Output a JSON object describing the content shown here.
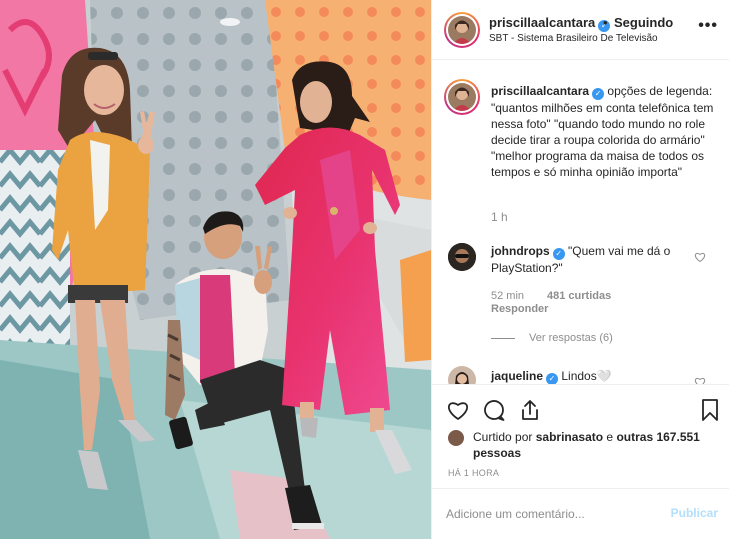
{
  "post": {
    "username": "priscillaalcantara",
    "separator": "•",
    "follow_status": "Seguindo",
    "location": "SBT - Sistema Brasileiro De Televisão",
    "more_label": "•••"
  },
  "caption": {
    "username": "priscillaalcantara",
    "text": "opções de legenda: \"quantos milhões em conta telefônica tem nessa foto\" \"quando todo mundo no role decide tirar a roupa colorida do armário\" \"melhor programa da maisa de todos os tempos e só minha opinião importa\"",
    "time": "1 h"
  },
  "comments": [
    {
      "username": "johndrops",
      "verified": true,
      "text": "\"Quem vai me dá o PlayStation?\"",
      "time": "52 min",
      "likes": "481 curtidas",
      "reply": "Responder",
      "view_replies": "Ver respostas (6)"
    },
    {
      "username": "jaqueline",
      "verified": true,
      "text": "Lindos🤍"
    }
  ],
  "likes": {
    "prefix": "Curtido por",
    "user": "sabrinasato",
    "middle": "e",
    "others": "outras 167.551 pessoas"
  },
  "timestamp": "HÁ 1 HORA",
  "add_comment": {
    "placeholder": "Adicione um comentário...",
    "publish_label": "Publicar"
  },
  "icons": {
    "like": "heart-icon",
    "comment": "comment-bubble-icon",
    "share": "share-icon",
    "save": "bookmark-icon",
    "verified": "verified-badge-icon"
  },
  "colors": {
    "verified": "#3897f0",
    "publish_disabled": "#b2dffc",
    "muted_text": "#8e8e8e",
    "text": "#262626"
  }
}
